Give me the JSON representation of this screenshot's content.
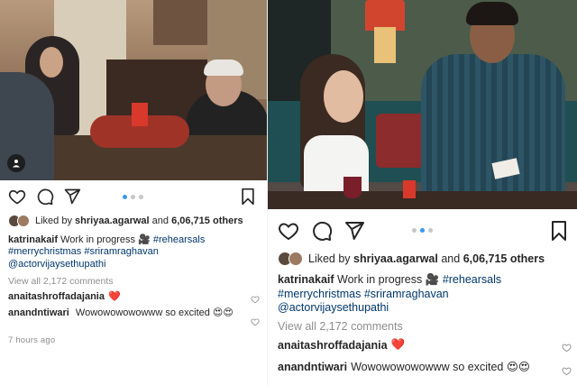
{
  "posts": [
    {
      "liked_by_user": "shriyaa.agarwal",
      "liked_by_prefix": "Liked by",
      "liked_by_conj": "and",
      "likes_count": "6,06,715 others",
      "caption_user": "katrinakaif",
      "caption_text": "Work in progress",
      "caption_emoji": "🎥",
      "caption_tag1": "#rehearsals",
      "caption_tag2": "#merrychristmas #sriramraghavan",
      "caption_tag3": "@actorvijaysethupathi",
      "view_all": "View all 2,172 comments",
      "comments": [
        {
          "user": "anaitashroffadajania",
          "text": "❤️"
        },
        {
          "user": "anandntiwari",
          "text": "Wowowowowowww so excited 😍😍"
        }
      ],
      "timestamp": "7 hours ago",
      "carousel_index": 1,
      "carousel_total": 3
    },
    {
      "liked_by_user": "shriyaa.agarwal",
      "liked_by_prefix": "Liked by",
      "liked_by_conj": "and",
      "likes_count": "6,06,715 others",
      "caption_user": "katrinakaif",
      "caption_text": "Work in progress",
      "caption_emoji": "🎥",
      "caption_tag1": "#rehearsals",
      "caption_tag2": "#merrychristmas #sriramraghavan",
      "caption_tag3": "@actorvijaysethupathi",
      "view_all": "View all 2,172 comments",
      "comments": [
        {
          "user": "anaitashroffadajania",
          "text": "❤️"
        },
        {
          "user": "anandntiwari",
          "text": "Wowowowowowww so excited 😍😍"
        }
      ],
      "carousel_index": 2,
      "carousel_total": 3
    }
  ],
  "icons": {
    "like": "heart-icon",
    "comment": "comment-icon",
    "share": "paper-plane-icon",
    "save": "bookmark-icon",
    "user_tag": "user-tag-icon"
  },
  "colors": {
    "text": "#262626",
    "muted": "#8e8e8e",
    "hashtag": "#00376b",
    "carousel_active": "#3897f0",
    "heart_red": "#ed4956"
  }
}
